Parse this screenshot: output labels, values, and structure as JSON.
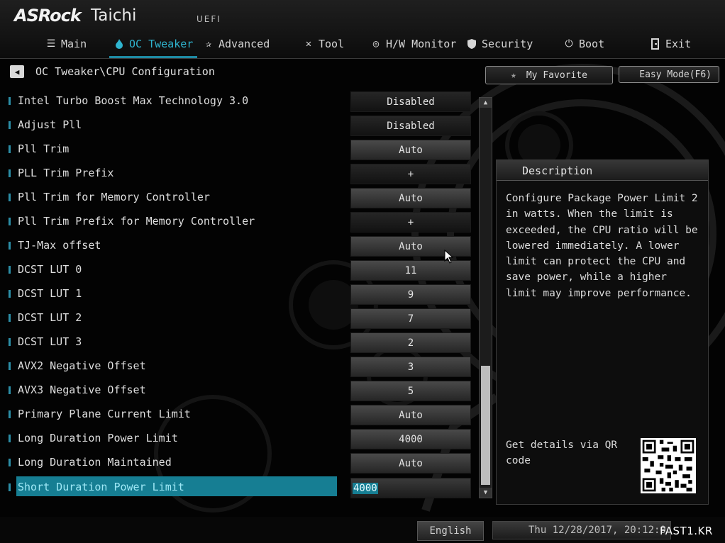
{
  "brand": {
    "name": "ASRock",
    "model": "Taichi",
    "firmware": "UEFI"
  },
  "nav": {
    "tabs": [
      {
        "label": "Main",
        "icon": "list-icon",
        "active": false
      },
      {
        "label": "OC Tweaker",
        "icon": "flame-icon",
        "active": true
      },
      {
        "label": "Advanced",
        "icon": "star-icon",
        "active": false
      },
      {
        "label": "Tool",
        "icon": "tools-icon",
        "active": false
      },
      {
        "label": "H/W Monitor",
        "icon": "monitor-icon",
        "active": false
      },
      {
        "label": "Security",
        "icon": "shield-icon",
        "active": false
      },
      {
        "label": "Boot",
        "icon": "power-icon",
        "active": false
      },
      {
        "label": "Exit",
        "icon": "exit-icon",
        "active": false
      }
    ]
  },
  "breadcrumb": "OC Tweaker\\CPU Configuration",
  "favorite_label": "My Favorite",
  "easy_mode_label": "Easy Mode(F6)",
  "settings": [
    {
      "label": "Intel Turbo Boost Max Technology 3.0",
      "value": "Disabled"
    },
    {
      "label": "Adjust Pll",
      "value": "Disabled"
    },
    {
      "label": "Pll Trim",
      "value": "Auto"
    },
    {
      "label": "PLL Trim Prefix",
      "value": "+"
    },
    {
      "label": "Pll Trim for Memory Controller",
      "value": "Auto"
    },
    {
      "label": "Pll Trim Prefix for Memory Controller",
      "value": "+"
    },
    {
      "label": "TJ-Max offset",
      "value": "Auto"
    },
    {
      "label": "DCST LUT 0",
      "value": "11"
    },
    {
      "label": "DCST LUT 1",
      "value": "9"
    },
    {
      "label": "DCST LUT 2",
      "value": "7"
    },
    {
      "label": "DCST LUT 3",
      "value": "2"
    },
    {
      "label": "AVX2 Negative Offset",
      "value": "3"
    },
    {
      "label": "AVX3 Negative Offset",
      "value": "5"
    },
    {
      "label": "Primary Plane Current Limit",
      "value": "Auto"
    },
    {
      "label": "Long Duration Power Limit",
      "value": "4000"
    },
    {
      "label": "Long Duration Maintained",
      "value": "Auto"
    },
    {
      "label": "Short Duration Power Limit",
      "value": "4000"
    }
  ],
  "description": {
    "title": "Description",
    "text": "Configure Package Power Limit 2 in watts. When the limit is exceeded, the CPU ratio will be lowered immediately. A lower limit can protect the CPU and save power, while a higher limit may improve performance.",
    "qr_text": "Get details via QR code"
  },
  "footer": {
    "language": "English",
    "datetime": "Thu 12/28/2017, 20:12:0"
  },
  "watermark": "FAST1.KR",
  "colors": {
    "accent": "#1fb4d1",
    "highlight": "#167e93"
  }
}
